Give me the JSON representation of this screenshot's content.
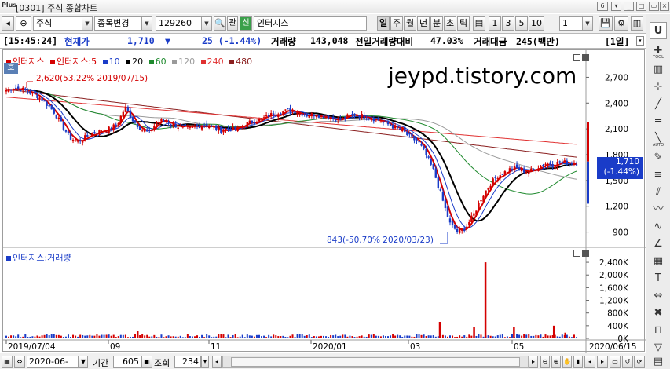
{
  "window": {
    "logo": "Plus",
    "title": "[0301] 주식 종합차트",
    "count_badge": "6"
  },
  "toolbar": {
    "market_code": "0",
    "asset_type": "주식",
    "mode": "종목변경",
    "stock_code": "129260",
    "related_label": "관",
    "credit_label": "신",
    "stock_name": "인터지스",
    "periods": [
      "일",
      "주",
      "월",
      "년",
      "분",
      "초",
      "틱"
    ],
    "selected_period": "일",
    "intervals": [
      "1",
      "3",
      "5",
      "10"
    ],
    "interval_value": "1"
  },
  "quote": {
    "time": "[15:45:24]",
    "price_label": "현재가",
    "price": "1,710",
    "change_arrow": "▼",
    "change": "25 (-1.44%)",
    "volume_label": "거래량",
    "volume": "143,048",
    "prev_ratio_label": "전일거래량대비",
    "prev_ratio": "47.03%",
    "amount_label": "거래대금",
    "amount": "245(백만)",
    "unit": "[1일]"
  },
  "chart": {
    "price_legend": [
      {
        "text": "인터지스",
        "color": "#d40000"
      },
      {
        "text": "인터지스:5",
        "color": "#d40000"
      },
      {
        "text": "10",
        "color": "#1a3cc8"
      },
      {
        "text": "20",
        "color": "#000000"
      },
      {
        "text": "60",
        "color": "#1f8a2e"
      },
      {
        "text": "120",
        "color": "#9a9a9a"
      },
      {
        "text": "240",
        "color": "#e03030"
      },
      {
        "text": "480",
        "color": "#8b2020"
      }
    ],
    "ho_label": "호",
    "watermark": "jeypd.tistory.com",
    "high_annotation": "2,620(53.22% 2019/07/15)",
    "low_annotation": "843(-50.70% 2020/03/23)",
    "current_tag": "1,710",
    "current_tag_pct": "(-1.44%)",
    "volume_legend": "인터지스:거래량",
    "price_axis": [
      "2,700",
      "2,400",
      "2,100",
      "1,800",
      "1,500",
      "1,200",
      "900"
    ],
    "volume_axis": [
      "2,400K",
      "2,000K",
      "1,600K",
      "1,200K",
      "800K",
      "400K",
      "0K"
    ],
    "date_axis": [
      "2019/07/04",
      "09",
      "11",
      "2020/01",
      "03",
      "05",
      "2020/06/15"
    ]
  },
  "chart_data": {
    "type": "candlestick",
    "ylim": [
      750,
      2850
    ],
    "y_ticks": [
      900,
      1200,
      1500,
      1800,
      2100,
      2400,
      2700
    ],
    "volume_ylim": [
      0,
      2600000
    ],
    "volume_ticks": [
      0,
      400000,
      800000,
      1200000,
      1600000,
      2000000,
      2400000
    ],
    "x_labels": [
      "2019/07/04",
      "09",
      "11",
      "2020/01",
      "03",
      "05",
      "2020/06/15"
    ],
    "high": {
      "value": 2620,
      "date": "2019/07/15"
    },
    "low": {
      "value": 843,
      "date": "2020/03/23"
    },
    "last": 1710,
    "close_path": [
      2550,
      2580,
      2560,
      2520,
      2480,
      2400,
      2300,
      2150,
      2000,
      1950,
      2000,
      2050,
      2080,
      2100,
      2150,
      2350,
      2200,
      2100,
      2050,
      2180,
      2200,
      2150,
      2120,
      2100,
      2130,
      2150,
      2120,
      2080,
      2100,
      2090,
      2150,
      2180,
      2200,
      2250,
      2280,
      2300,
      2320,
      2290,
      2260,
      2270,
      2250,
      2230,
      2200,
      2240,
      2270,
      2250,
      2230,
      2200,
      2160,
      2120,
      2080,
      2000,
      1950,
      1800,
      1600,
      1300,
      1000,
      900,
      950,
      1100,
      1300,
      1450,
      1550,
      1600,
      1650,
      1620,
      1600,
      1650,
      1700,
      1680,
      1720,
      1700,
      1710
    ],
    "volume_series": [
      {
        "date_pos": 0.23,
        "value": 230000
      },
      {
        "date_pos": 0.84,
        "value": 2400000
      },
      {
        "date_pos": 0.76,
        "value": 520000
      },
      {
        "date_pos": 0.82,
        "value": 350000
      },
      {
        "date_pos": 0.89,
        "value": 350000
      },
      {
        "date_pos": 0.96,
        "value": 400000
      },
      {
        "date_pos": 0.98,
        "value": 180000
      }
    ],
    "moving_averages": [
      {
        "name": "5",
        "color": "#d40000"
      },
      {
        "name": "10",
        "color": "#1a3cc8"
      },
      {
        "name": "20",
        "color": "#000000"
      },
      {
        "name": "60",
        "color": "#1f8a2e"
      },
      {
        "name": "120",
        "color": "#9a9a9a"
      },
      {
        "name": "240",
        "color": "#e03030"
      },
      {
        "name": "480",
        "color": "#8b2020"
      }
    ]
  },
  "bottom": {
    "date": "2020-06-08",
    "period_label": "기간",
    "period_value": "605",
    "view_label": "조회",
    "view_value": "234"
  },
  "tools": [
    "U",
    "TOOL",
    "AUTO"
  ]
}
